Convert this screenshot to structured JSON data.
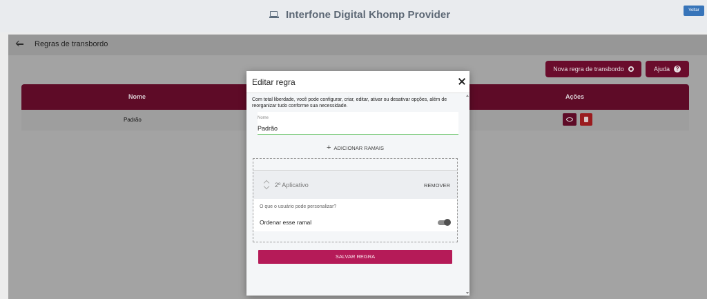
{
  "app": {
    "title": "Interfone Digital Khomp Provider",
    "voltar_label": "Voltar"
  },
  "subheader": {
    "title": "Regras de transbordo"
  },
  "actions": {
    "new_rule_label": "Nova regra de transbordo",
    "help_label": "Ajuda"
  },
  "table": {
    "columns": [
      "Nome",
      "Ações"
    ],
    "rows": [
      {
        "name": "Padrão"
      }
    ]
  },
  "modal": {
    "title": "Editar regra",
    "description": "Com total liberdade, você pode configurar, criar, editar, ativar ou desativar opções, além de reorganizar tudo conforme sua necessidade.",
    "name_label": "Nome",
    "name_value": "Padrão",
    "add_ramais_label": "ADICIONAR RAMAIS",
    "ramal": {
      "name": "2º Aplicativo",
      "remove_label": "REMOVER",
      "question": "O que o usuário pode personalizar?",
      "option_label": "Ordenar esse ramal",
      "option_enabled": true
    },
    "save_label": "SALVAR REGRA"
  },
  "colors": {
    "primary": "#b51b58",
    "header_dark": "#6a0c2c",
    "voltar_blue": "#3774b9"
  },
  "icons": {
    "laptop": "laptop-icon",
    "back": "arrow-left-icon",
    "gear": "gear-icon",
    "help": "help-circle-icon",
    "eye": "eye-icon",
    "trash": "trash-icon",
    "close": "close-icon",
    "drag": "drag-handle-icon",
    "plus": "plus-icon"
  }
}
